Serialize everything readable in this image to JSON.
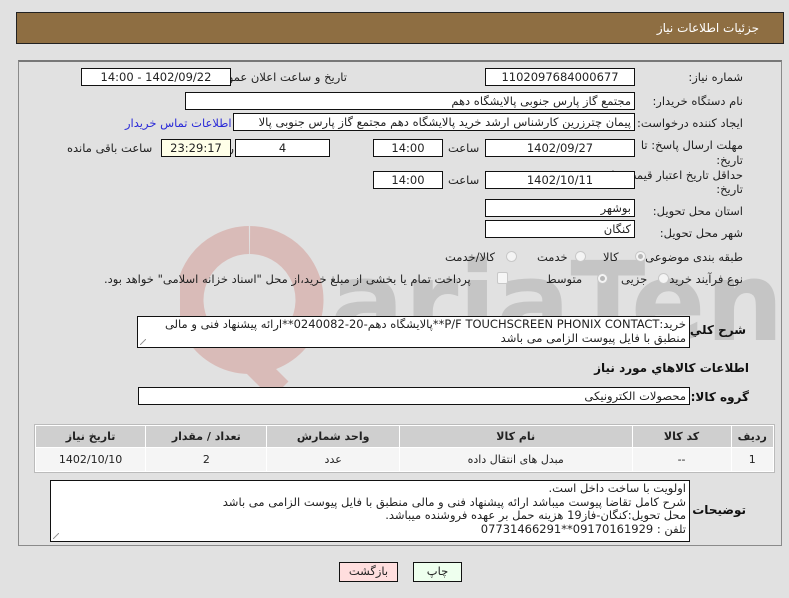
{
  "header": {
    "title": "جزئیات اطلاعات نیاز"
  },
  "form": {
    "need_number": {
      "label": "شماره نیاز:",
      "value": "1102097684000677"
    },
    "announce": {
      "label": "تاریخ و ساعت اعلان عمومی:",
      "value": "1402/09/22 - 14:00"
    },
    "buyer_org": {
      "label": "نام دستگاه خریدار:",
      "value": "مجتمع گاز پارس جنوبی  پالایشگاه دهم"
    },
    "requester": {
      "label": "ایجاد کننده درخواست:",
      "value": "پیمان چترزرین کارشناس ارشد خرید پالایشگاه دهم مجتمع گاز پارس جنوبی  پالا",
      "contact_link": "اطلاعات تماس خریدار"
    },
    "reply_deadline": {
      "label_line1": "مهلت ارسال پاسخ: تا",
      "label_line2": "تاریخ:",
      "date": "1402/09/27",
      "time_label": "ساعت",
      "time": "14:00",
      "days": "4",
      "days_label": "روز و",
      "remaining": "23:29:17",
      "remaining_label": "ساعت باقی مانده"
    },
    "price_validity": {
      "label_line1": "حداقل تاریخ اعتبار قیمت: تا",
      "label_line2": "تاریخ:",
      "date": "1402/10/11",
      "time_label": "ساعت",
      "time": "14:00"
    },
    "province": {
      "label": "استان محل تحویل:",
      "value": "بوشهر"
    },
    "city": {
      "label": "شهر محل تحویل:",
      "value": "کنگان"
    },
    "category": {
      "label": "طبقه بندی موضوعی:",
      "options": [
        "کالا",
        "خدمت",
        "کالا/خدمت"
      ],
      "selected": "کالا"
    },
    "purchase_type": {
      "label": "نوع فرآیند خرید :",
      "options": [
        "جزیی",
        "متوسط"
      ],
      "selected": "متوسط",
      "treasury_note": "پرداخت تمام یا بخشی از مبلغ خرید،از محل \"اسناد خزانه اسلامی\" خواهد بود."
    },
    "description": {
      "label": "شرح کلي نیاز:",
      "value": "خرید:P/F TOUCHSCREEN PHONIX CONTACT**پالایشگاه دهم-20-0240082**ارائه پیشنهاد فنی و مالی منطبق با فایل پیوست الزامی می باشد"
    },
    "goods_section_title": "اطلاعات کالاهاي مورد نیاز",
    "goods_group": {
      "label": "گروه کالا:",
      "value": "محصولات الکترونیکی"
    }
  },
  "table": {
    "headers": [
      "ردیف",
      "کد کالا",
      "نام کالا",
      "واحد شمارش",
      "تعداد / مقدار",
      "تاریخ نیاز"
    ],
    "rows": [
      [
        "1",
        "--",
        "مبدل های انتقال داده",
        "عدد",
        "2",
        "1402/10/10"
      ]
    ]
  },
  "buyer_notes": {
    "label": "توضیحات خریدار:",
    "lines": [
      "اولویت با ساخت داخل است.",
      "شرح کامل تقاضا پیوست میباشد ارائه پیشنهاد فنی و مالی منطبق با فایل پیوست الزامی می باشد",
      "محل تحویل:کنگان-فاز19 هزینه حمل بر عهده فروشنده میباشد.",
      "تلفن : 09170161929**07731466291"
    ]
  },
  "buttons": {
    "print": "چاپ",
    "back": "بازگشت"
  },
  "colors": {
    "header_bg": "#8e6e42",
    "print_bg": "#eeffee",
    "back_bg": "#ffdede",
    "link": "#2a2ad8"
  }
}
